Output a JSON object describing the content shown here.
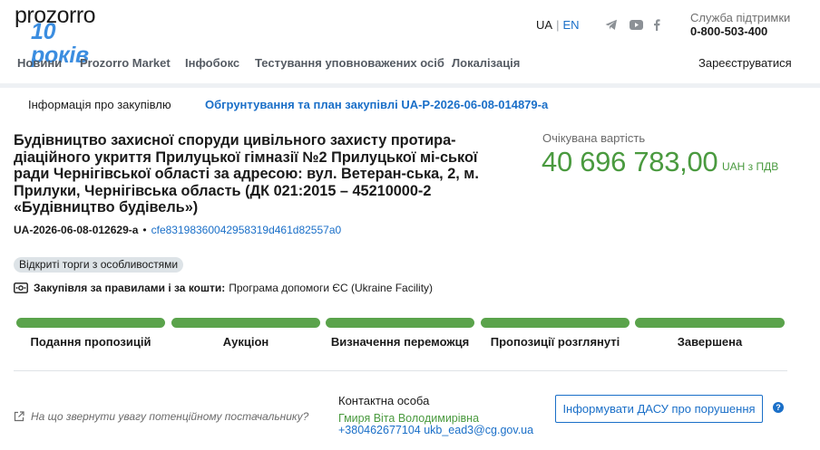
{
  "header": {
    "logo_top": "prozorro",
    "logo_bottom": "10 років",
    "lang_ua": "UA",
    "lang_sep": "|",
    "lang_en": "EN",
    "social_icons": [
      "telegram-icon",
      "youtube-icon",
      "facebook-icon"
    ],
    "support_label": "Служба підтримки",
    "support_phone": "0-800-503-400"
  },
  "nav": {
    "items": [
      "Новини",
      "Prozorro Market",
      "Інфобокс",
      "Тестування уповноважених осіб",
      "Локалізація"
    ],
    "register": "Зареєструватися"
  },
  "tabs": {
    "active": "Інформація про закупівлю",
    "link": "Обгрунтування та план закупівлі UA-P-2026-06-08-014879-a"
  },
  "tender": {
    "title": "Будівництво захисної споруди цивільного захисту протира-діаційного укриття Прилуцької гімназії №2 Прилуцької мі-ської ради Чернігівської області за адресою: вул. Ветеран-ська, 2, м. Прилуки, Чернігівська область (ДК 021:2015 – 45210000-2 «Будівництво будівель»)",
    "tender_id": "UA-2026-06-08-012629-a",
    "separator": "•",
    "hash": "cfe83198360042958319d461d82557a0",
    "badge": "Відкриті торги з особливостями",
    "rules_label": "Закупівля за правилами і за кошти:",
    "rules_value": "Програма допомоги ЄС (Ukraine Facility)",
    "expected_cost_label": "Очікувана вартість",
    "expected_cost_value": "40 696 783,00",
    "expected_cost_currency": "UAH з ПДВ"
  },
  "progress": {
    "completed_steps": 5,
    "total_steps": 5,
    "steps": [
      "Подання пропозицій",
      "Аукціон",
      "Визначення переможця",
      "Пропозиції розглянуті",
      "Завершена"
    ]
  },
  "footer": {
    "hint": "На що звернути увагу потенційному постачальнику?",
    "contact_title": "Контактна особа",
    "contact_name": "Гмиря Віта Володимирівна",
    "contact_phone": "+380462677104 ukb_ead3@cg.gov.ua",
    "report_button": "Інформувати ДАСУ про порушення",
    "help_glyph": "?"
  },
  "colors": {
    "accent_blue": "#1a6fc8",
    "accent_green": "#4a9a3f",
    "progress_green": "#5aa34b"
  }
}
